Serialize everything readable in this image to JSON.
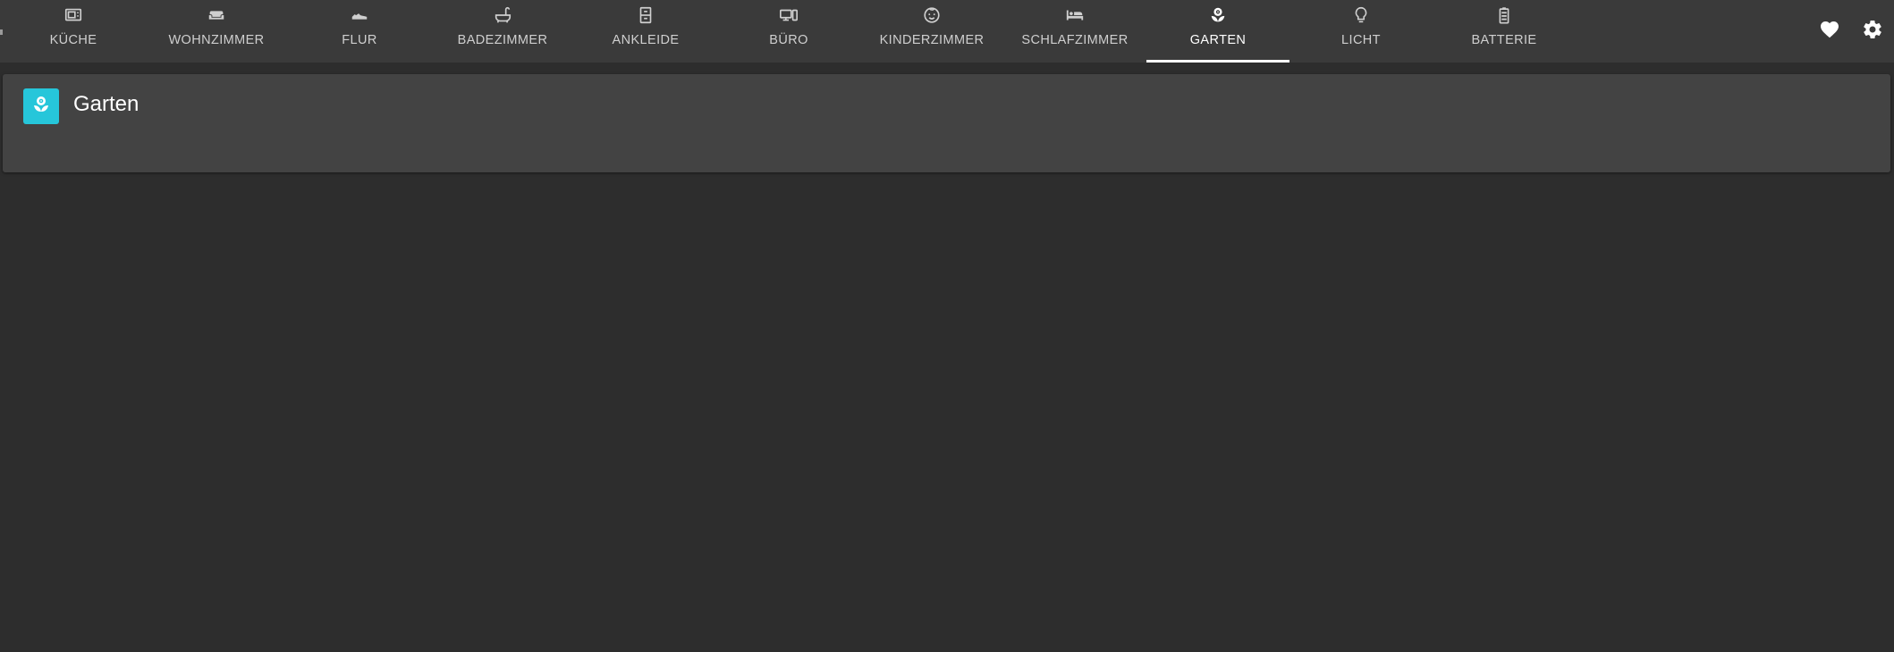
{
  "nav": {
    "tabs": [
      {
        "label": "KÜCHE",
        "icon": "microwave-icon"
      },
      {
        "label": "WOHNZIMMER",
        "icon": "sofa-icon"
      },
      {
        "label": "FLUR",
        "icon": "shoe-icon"
      },
      {
        "label": "BADEZIMMER",
        "icon": "bathtub-icon"
      },
      {
        "label": "ANKLEIDE",
        "icon": "wardrobe-icon"
      },
      {
        "label": "BÜRO",
        "icon": "desktop-icon"
      },
      {
        "label": "KINDERZIMMER",
        "icon": "baby-face-icon"
      },
      {
        "label": "SCHLAFZIMMER",
        "icon": "bed-icon"
      },
      {
        "label": "GARTEN",
        "icon": "flower-icon",
        "active": true
      },
      {
        "label": "LICHT",
        "icon": "lightbulb-icon"
      },
      {
        "label": "BATTERIE",
        "icon": "battery-icon"
      }
    ],
    "actions": {
      "favorite_icon": "heart-icon",
      "settings_icon": "gear-icon"
    }
  },
  "card": {
    "title": "Garten",
    "icon": "flower-icon",
    "icon_bg": "#26c6da"
  },
  "colors": {
    "background": "#2d2d2d",
    "topbar": "#3a3a3a",
    "card": "#434343",
    "accent": "#26c6da"
  }
}
